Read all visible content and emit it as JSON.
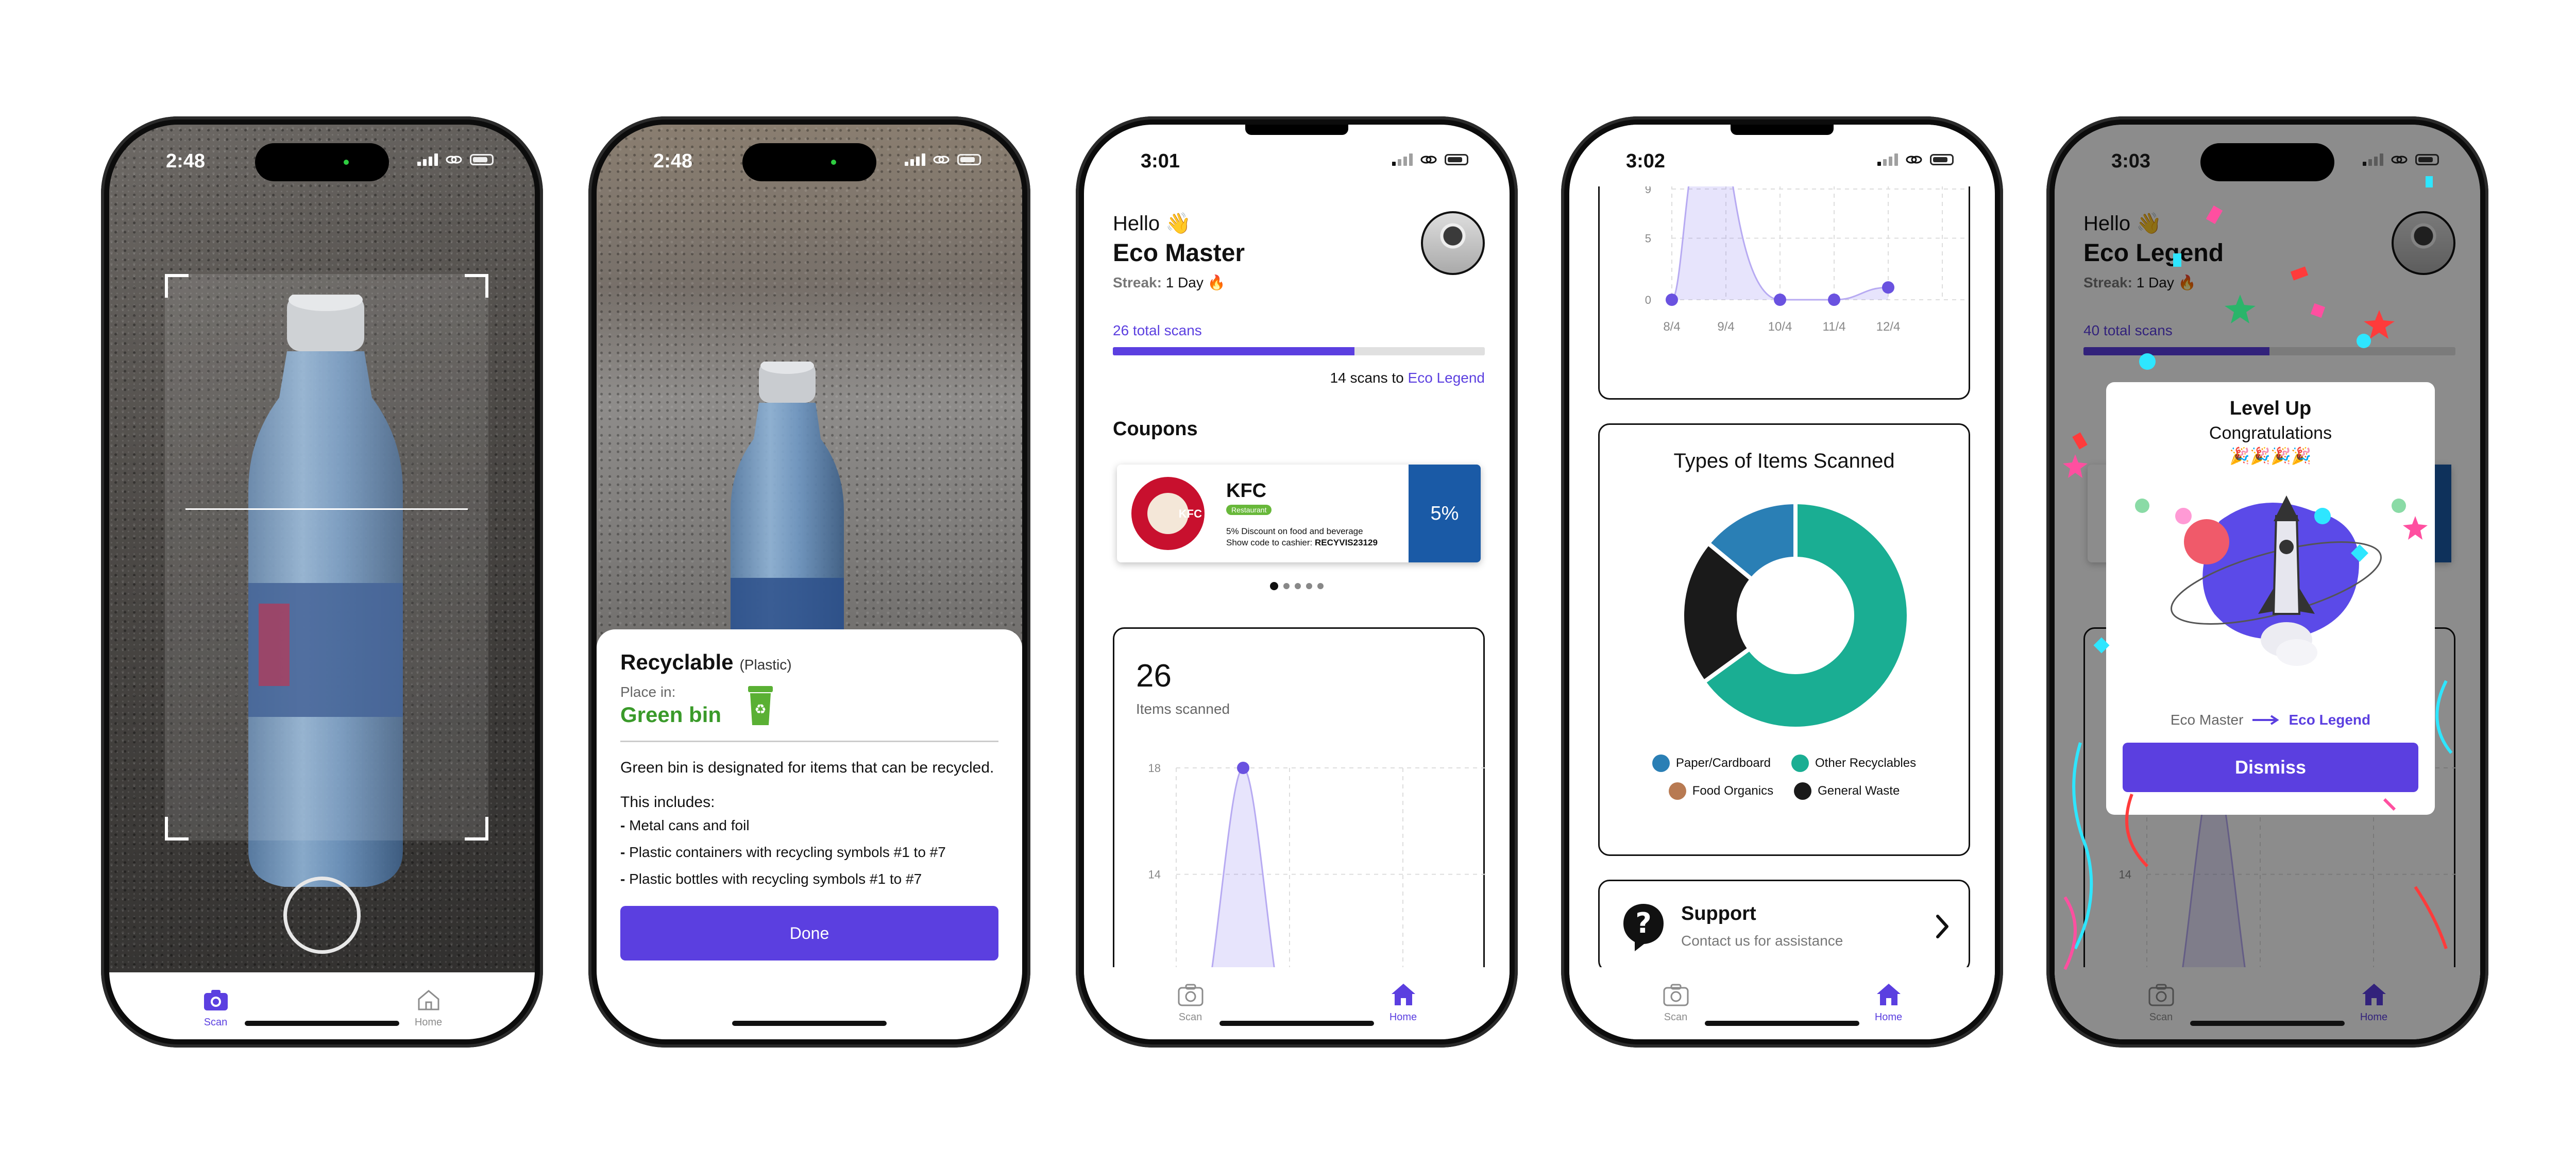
{
  "phone1": {
    "time": "2:48",
    "tabs": [
      {
        "label": "Scan",
        "active": true
      },
      {
        "label": "Home",
        "active": false
      }
    ]
  },
  "phone2": {
    "time": "2:48",
    "result": {
      "title": "Recyclable",
      "category": "(Plastic)",
      "place_label": "Place in:",
      "bin": "Green bin",
      "description": "Green bin is designated for items that can be recycled.",
      "includes_label": "This includes:",
      "items": [
        "Metal cans and foil",
        "Plastic containers with recycling symbols #1 to #7",
        "Plastic bottles with recycling symbols #1 to #7"
      ],
      "done_label": "Done"
    },
    "colors": {
      "bin_green": "#3a9a2a",
      "accent": "#5b3fe0"
    }
  },
  "phone3": {
    "time": "3:01",
    "greeting": "Hello 👋",
    "name": "Eco Master",
    "streak_label": "Streak:",
    "streak_value": "1 Day 🔥",
    "total_scans": "26 total scans",
    "progress": 0.65,
    "next_level_text": "14 scans to",
    "next_level": "Eco Legend",
    "coupons_title": "Coupons",
    "coupon": {
      "brand": "KFC",
      "badge": "Restaurant",
      "line1": "5% Discount on food and beverage",
      "line2_label": "Show code to cashier:",
      "code": "RECYVIS23129",
      "discount": "5%",
      "logo_text": "KFC"
    },
    "items_count": "26",
    "items_label": "Items scanned",
    "tabs": [
      {
        "label": "Scan",
        "active": false
      },
      {
        "label": "Home",
        "active": true
      }
    ]
  },
  "phone4": {
    "time": "3:02",
    "pie_title": "Types of Items Scanned",
    "support_title": "Support",
    "support_subtitle": "Contact us for assistance",
    "tabs": [
      {
        "label": "Scan",
        "active": false
      },
      {
        "label": "Home",
        "active": true
      }
    ]
  },
  "phone5": {
    "time": "3:03",
    "greeting": "Hello 👋",
    "name": "Eco Legend",
    "streak_label": "Streak:",
    "streak_value": "1 Day 🔥",
    "total_scans": "40 total scans",
    "progress": 0.5,
    "modal": {
      "title": "Level Up",
      "subtitle": "Congratulations",
      "emojis": "🎉🎉🎉🎉",
      "from_level": "Eco Master",
      "to_level": "Eco Legend",
      "dismiss_label": "Dismiss"
    },
    "tabs": [
      {
        "label": "Scan",
        "active": false
      },
      {
        "label": "Home",
        "active": true
      }
    ]
  },
  "chart_data": [
    {
      "type": "area",
      "title": "",
      "categories": [
        "8/4",
        "9/4",
        "10/4",
        "11/4",
        "12/4"
      ],
      "values": [
        18,
        0,
        0,
        0,
        1
      ],
      "yticks": [
        0,
        5,
        9,
        14,
        18
      ],
      "ylim": [
        0,
        18
      ],
      "grid": true
    },
    {
      "type": "pie",
      "title": "Types of Items Scanned",
      "labels": [
        "Other Recyclables",
        "General Waste",
        "Paper/Cardboard",
        "Food Organics"
      ],
      "values": [
        65,
        21,
        14,
        0
      ],
      "colors": [
        "#1aae93",
        "#1a1a1a",
        "#2a7fb5",
        "#b87a52"
      ],
      "legend": "bottom"
    }
  ]
}
